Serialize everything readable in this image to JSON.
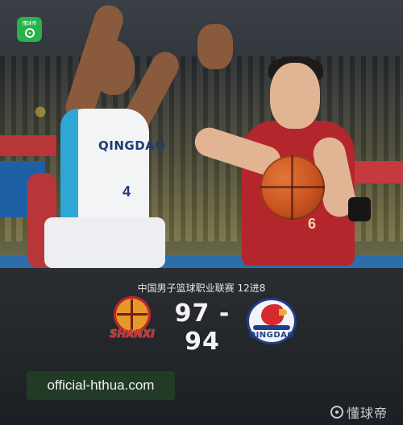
{
  "app_badge": {
    "label": "懂球帝",
    "icon": "soccer-ball-icon",
    "color": "#27b24a"
  },
  "photo": {
    "white_player_jersey_text": "QINGDAO",
    "white_player_number": "4",
    "red_player_number": "6"
  },
  "match": {
    "title": "中国男子篮球职业联赛 12进8",
    "score": "97 - 94",
    "home_team_logo_text": "SHANXI",
    "away_team_logo_text": "QINGDAO"
  },
  "watermark_site": "official-hthua.com",
  "brand": {
    "name": "懂球帝",
    "icon": "soccer-ball-icon"
  },
  "colors": {
    "panel_bg": "#1c1f23",
    "badge_green": "#27b24a",
    "site_box_bg": "#213b26",
    "home_red": "#d52a2a",
    "away_blue": "#1f3f86"
  }
}
